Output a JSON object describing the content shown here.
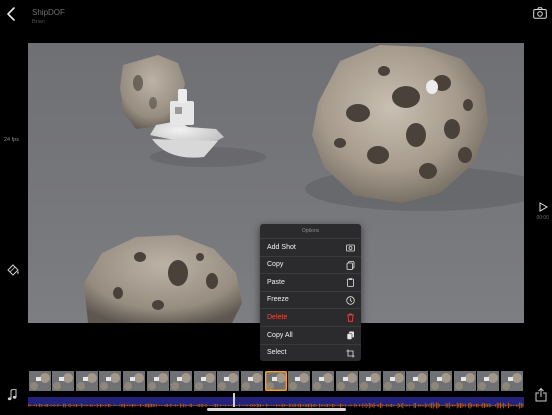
{
  "header": {
    "title": "ShipDOF",
    "subtitle": "Brian",
    "back_icon": "chevron-left-icon",
    "camera_icon": "camera-icon"
  },
  "sidebar": {
    "fps_label": "24 fps",
    "fill_icon": "paint-bucket-icon",
    "music_icon": "music-note-icon"
  },
  "playback": {
    "play_icon": "play-icon",
    "timecode": "00:00",
    "share_icon": "share-icon"
  },
  "menu": {
    "title": "Options",
    "items": [
      {
        "label": "Add Shot",
        "icon": "camera-icon"
      },
      {
        "label": "Copy",
        "icon": "copy-icon"
      },
      {
        "label": "Paste",
        "icon": "paste-icon"
      },
      {
        "label": "Freeze",
        "icon": "clock-icon"
      },
      {
        "label": "Delete",
        "icon": "trash-icon",
        "destructive": true
      },
      {
        "label": "Copy All",
        "icon": "copy-all-icon"
      },
      {
        "label": "Select",
        "icon": "select-crop-icon"
      }
    ]
  },
  "filmstrip": {
    "frame_count": 21,
    "selected_index": 10
  },
  "colors": {
    "background": "#000000",
    "menu_bg": "#2b2b2d",
    "destructive": "#ff453a",
    "timeline": "#23227a",
    "waveform": "#c2620f"
  }
}
